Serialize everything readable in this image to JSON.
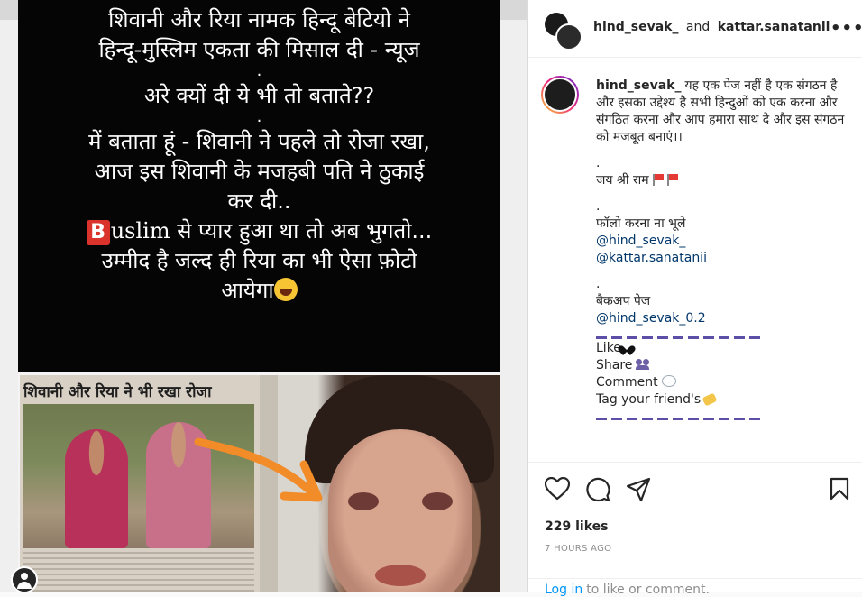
{
  "media": {
    "card_lines": [
      "शिवानी और रिया नामक हिन्दू बेटियो ने",
      "हिन्दू-मुस्लिम एकता की मिसाल दी - न्यूज",
      "अरे क्यों दी ये भी तो बताते??",
      "में बताता हूं - शिवानी ने पहले तो रोजा रखा,",
      "आज इस शिवानी के मजहबी पति ने ठुकाई",
      "कर दी.."
    ],
    "dot": ".",
    "b_letter": "B",
    "b_suffix": "uslim",
    "b_rest": " से प्यार हुआ था तो अब भुगतो...",
    "last_line_1": "उम्मीद है जल्द ही रिया का भी ऐसा फ़ोटो",
    "last_line_2": "आयेगा",
    "news_headline": "शिवानी और रिया ने भी रखा रोजा"
  },
  "header": {
    "user1": "hind_sevak_",
    "and_text": "and",
    "user2": "kattar.sanatanii",
    "more": "•••"
  },
  "caption": {
    "user": "hind_sevak_",
    "text": "यह एक पेज नहीं है एक संगठन है और इसका उद्देश्य है सभी हिन्दुओं को एक करना और संगठित करना और आप हमारा साथ दे और इस संगठन को मजबूत बनाएं।।",
    "dot": ".",
    "jai": "जय श्री राम",
    "follow": "फॉलो करना ना भूले",
    "mention1": "@hind_sevak_",
    "mention2": "@kattar.sanatanii",
    "backup": "बैकअप पेज",
    "mention3": "@hind_sevak_0.2",
    "like": "Like",
    "share": "Share",
    "comment": "Comment",
    "tag": "Tag your friend's"
  },
  "actions": {
    "likes": "229 likes",
    "time": "7 HOURS AGO",
    "login_link": "Log in",
    "login_rest": "to like or comment."
  },
  "icons": {
    "like": "heart-icon",
    "comment": "comment-icon",
    "share": "share-icon",
    "save": "bookmark-icon"
  }
}
